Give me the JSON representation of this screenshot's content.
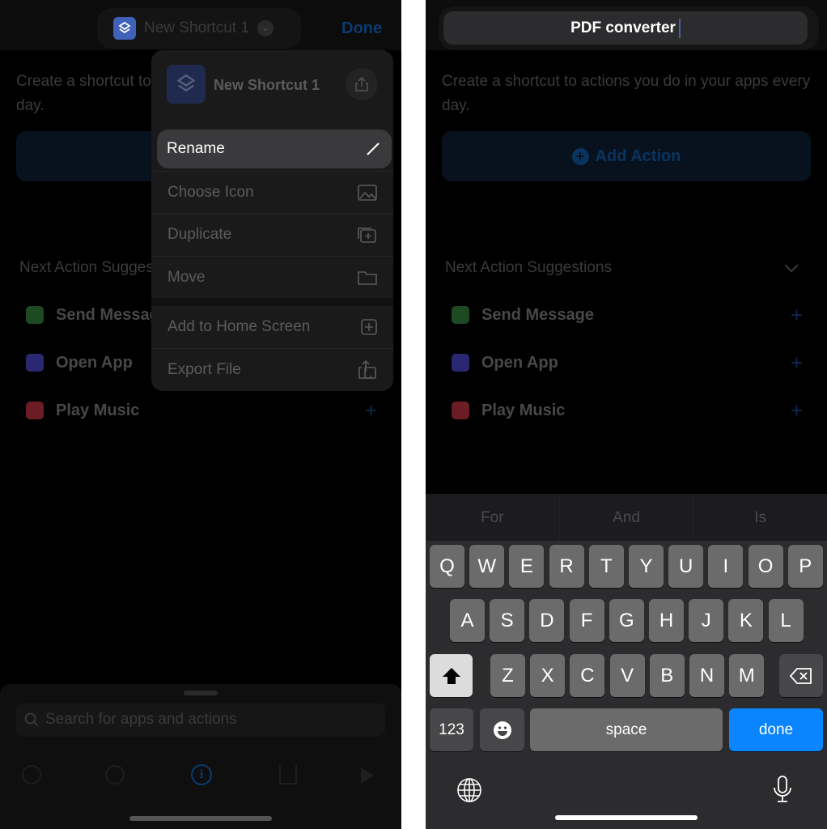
{
  "left": {
    "title": "New Shortcut 1",
    "done_label": "Done",
    "description": "Create a shortcut to actions you do in your apps every day.",
    "menu": {
      "header_title": "New Shortcut 1",
      "items": [
        {
          "label": "Rename",
          "icon": "pencil-icon"
        },
        {
          "label": "Choose Icon",
          "icon": "photo-icon"
        },
        {
          "label": "Duplicate",
          "icon": "duplicate-icon"
        },
        {
          "label": "Move",
          "icon": "folder-icon"
        },
        {
          "label": "Add to Home Screen",
          "icon": "plus-square-icon"
        },
        {
          "label": "Export File",
          "icon": "share-icon"
        }
      ]
    },
    "suggestions_header": "Next Action Suggestions",
    "suggestions": [
      {
        "label": "Send Message",
        "color": "#2f8a3a"
      },
      {
        "label": "Open App",
        "color": "#4a47b8"
      },
      {
        "label": "Play Music",
        "color": "#b0303c"
      }
    ],
    "search_placeholder": "Search for apps and actions"
  },
  "right": {
    "name_value": "PDF converter",
    "description": "Create a shortcut to actions you do in your apps every day.",
    "add_action_label": "Add Action",
    "suggestions_header": "Next Action Suggestions",
    "suggestions": [
      {
        "label": "Send Message",
        "color": "#2f8a3a"
      },
      {
        "label": "Open App",
        "color": "#4a47b8"
      },
      {
        "label": "Play Music",
        "color": "#b0303c"
      }
    ],
    "predictions": [
      "For",
      "And",
      "Is"
    ],
    "keyboard": {
      "row1": [
        "Q",
        "W",
        "E",
        "R",
        "T",
        "Y",
        "U",
        "I",
        "O",
        "P"
      ],
      "row2": [
        "A",
        "S",
        "D",
        "F",
        "G",
        "H",
        "J",
        "K",
        "L"
      ],
      "row3": [
        "Z",
        "X",
        "C",
        "V",
        "B",
        "N",
        "M"
      ],
      "numbers_label": "123",
      "space_label": "space",
      "done_label": "done",
      "accent": "#0a84ff"
    }
  }
}
